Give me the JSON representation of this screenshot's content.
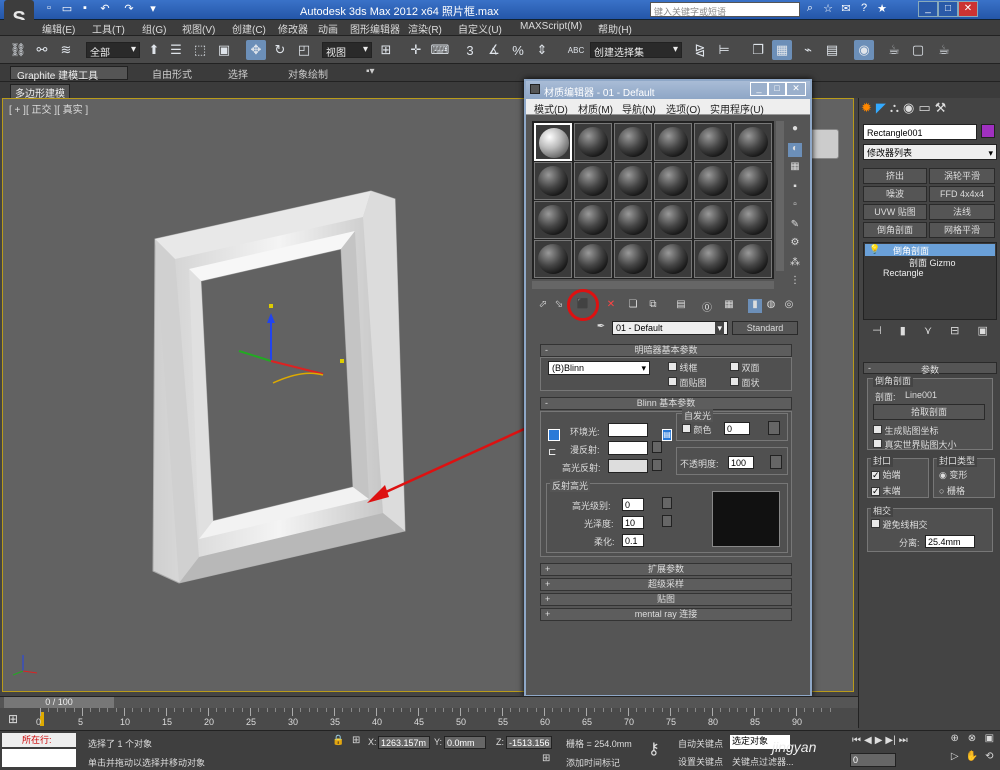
{
  "window": {
    "title": "Autodesk 3ds Max  2012 x64    照片框.max",
    "search_placeholder": "键入关键字或短语",
    "min": "_",
    "max": "□",
    "close": "✕"
  },
  "menu": [
    "编辑(E)",
    "工具(T)",
    "组(G)",
    "视图(V)",
    "创建(C)",
    "修改器",
    "动画",
    "图形编辑器",
    "渲染(R)",
    "自定义(U)",
    "MAXScript(M)",
    "帮助(H)"
  ],
  "toolbar": {
    "filter": "全部",
    "ref_coord": "视图",
    "named_sel": "创建选择集",
    "num_3": "3",
    "pct": "%",
    "abc": "ABC"
  },
  "ribbon": {
    "tabs": [
      "Graphite 建模工具",
      "自由形式",
      "选择",
      "对象绘制"
    ],
    "sub": "多边形建模"
  },
  "viewport": {
    "label": "[ + ][ 正交 ][ 真实 ]"
  },
  "material_editor": {
    "title": "材质编辑器 - 01 - Default",
    "menu": [
      "模式(D)",
      "材质(M)",
      "导航(N)",
      "选项(O)",
      "实用程序(U)"
    ],
    "material_name": "01 - Default",
    "material_type": "Standard",
    "shader_rollout": "明暗器基本参数",
    "shader": "(B)Blinn",
    "shader_opts": [
      "线框",
      "双面",
      "面贴图",
      "面状"
    ],
    "blinn_rollout": "Blinn 基本参数",
    "self_illum_group": "自发光",
    "color_label": "颜色",
    "color_value": "0",
    "ambient": "环境光:",
    "diffuse": "漫反射:",
    "specular": "高光反射:",
    "opacity_label": "不透明度:",
    "opacity_value": "100",
    "spec_group": "反射高光",
    "spec_level_label": "高光级别:",
    "spec_level": "0",
    "gloss_label": "光泽度:",
    "gloss": "10",
    "soften_label": "柔化:",
    "soften": "0.1",
    "rollouts": [
      "扩展参数",
      "超级采样",
      "贴图",
      "mental ray 连接"
    ]
  },
  "command_panel": {
    "object_name": "Rectangle001",
    "modifier_list": "修改器列表",
    "buttons": [
      "挤出",
      "涡轮平滑",
      "噪波",
      "FFD 4x4x4",
      "UVW 贴图",
      "法线",
      "倒角剖面",
      "网格平滑"
    ],
    "stack": [
      "倒角剖面",
      "剖面 Gizmo",
      "Rectangle"
    ],
    "params_rollout": "参数",
    "bevel_profile": "倒角剖面",
    "profile_label": "剖面:",
    "profile_value": "Line001",
    "pick_profile": "拾取剖面",
    "gen_map": "生成贴图坐标",
    "real_world": "真实世界贴图大小",
    "cap_group": "封口",
    "cap_start": "始端",
    "cap_end": "末端",
    "cap_type_group": "封口类型",
    "morph": "变形",
    "grid": "栅格",
    "intersect_group": "相交",
    "avoid_intersect": "避免线相交",
    "separation_label": "分离:",
    "separation_value": "25.4mm"
  },
  "timeline": {
    "frame": "0 / 100",
    "ticks": [
      "0",
      "5",
      "10",
      "15",
      "20",
      "25",
      "30",
      "35",
      "40",
      "45",
      "50",
      "55",
      "60",
      "65",
      "70",
      "75",
      "80",
      "85",
      "90"
    ]
  },
  "status": {
    "script_label": "所在行:",
    "selected": "选择了 1 个对象",
    "hint": "单击并拖动以选择并移动对象",
    "x_label": "X:",
    "x": "1263.157m",
    "y_label": "Y:",
    "y": "0.0mm",
    "z_label": "Z:",
    "z": "-1513.156",
    "grid": "栅格 = 254.0mm",
    "auto_key": "自动关键点",
    "set_key": "设置关键点",
    "selected_obj": "选定对象",
    "key_filters": "关键点过滤器...",
    "add_time_tag": "添加时间标记",
    "frame_field": "0",
    "watermark": "jingyan"
  }
}
